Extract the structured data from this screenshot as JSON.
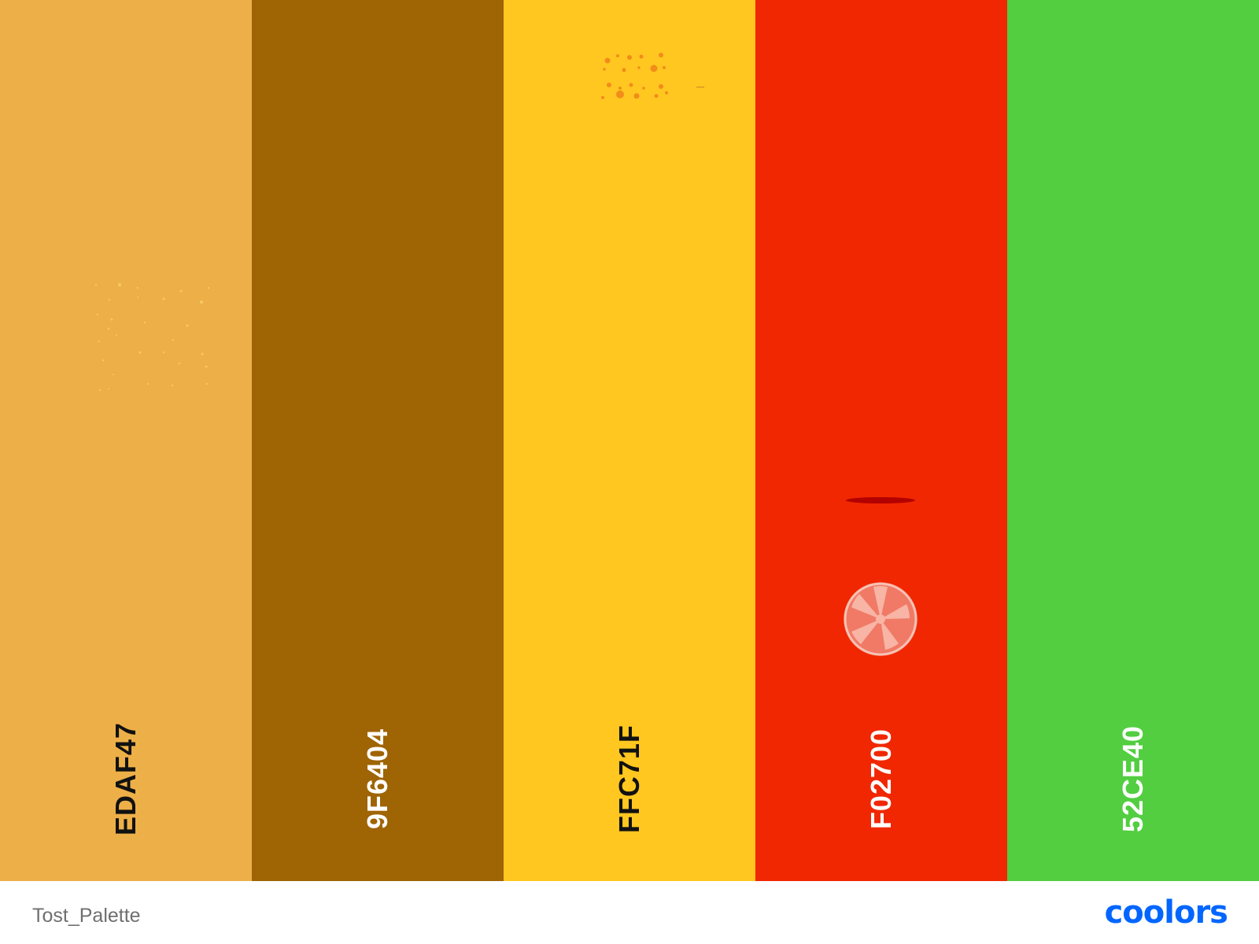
{
  "palette": {
    "swatches": [
      {
        "hex": "EDAF47",
        "color": "#EDAF47",
        "text_color": "dark",
        "decoration": "crumbs-icon"
      },
      {
        "hex": "9F6404",
        "color": "#9F6404",
        "text_color": "light",
        "decoration": ""
      },
      {
        "hex": "FFC71F",
        "color": "#FFC71F",
        "text_color": "dark",
        "decoration": "cheese-holes-icon"
      },
      {
        "hex": "F02700",
        "color": "#F02700",
        "text_color": "light",
        "decoration": "tomato-slice-icon"
      },
      {
        "hex": "52CE40",
        "color": "#52CE40",
        "text_color": "light",
        "decoration": ""
      }
    ]
  },
  "footer": {
    "palette_name": "Tost_Palette",
    "brand": "coolors",
    "brand_color": "#0066FF"
  }
}
